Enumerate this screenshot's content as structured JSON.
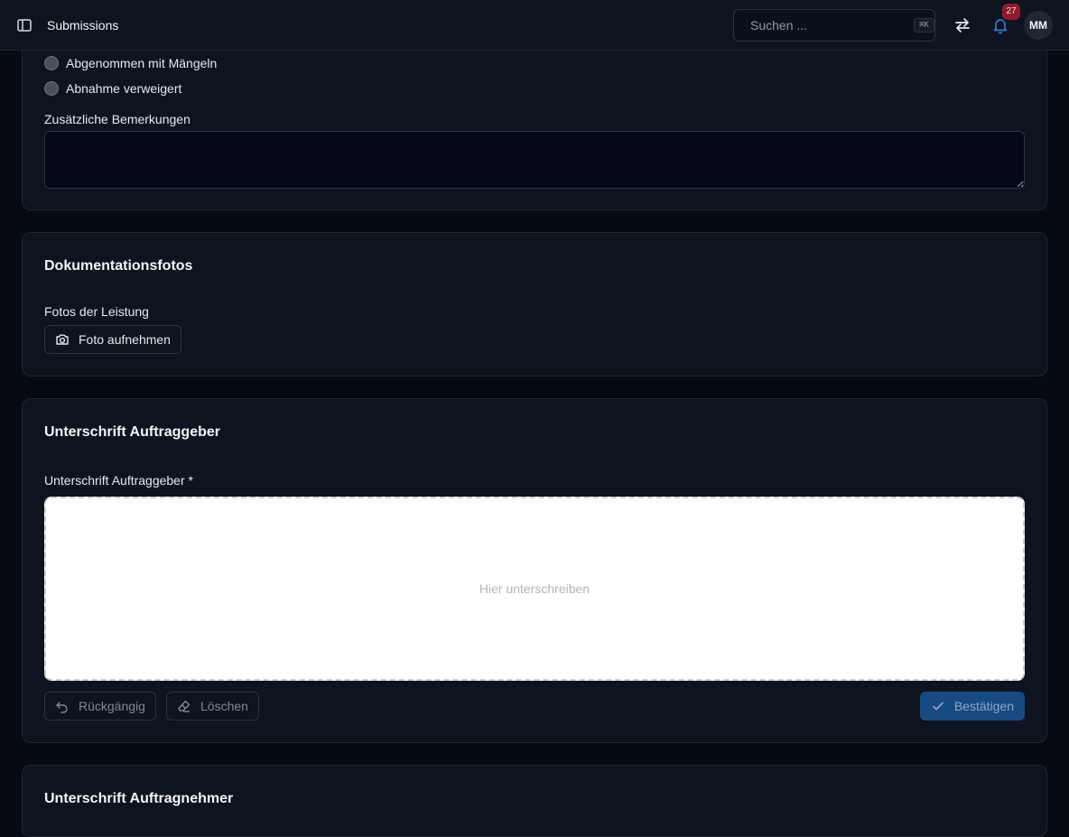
{
  "header": {
    "title": "Submissions",
    "search_placeholder": "Suchen ...",
    "search_shortcut": "⌘K",
    "notification_count": "27",
    "avatar_initials": "MM"
  },
  "acceptance": {
    "options": [
      "Abgenommen mit Mängeln",
      "Abnahme verweigert"
    ],
    "remarks_label": "Zusätzliche Bemerkungen",
    "remarks_value": ""
  },
  "photos": {
    "title": "Dokumentationsfotos",
    "field_label": "Fotos der Leistung",
    "take_photo_label": "Foto aufnehmen"
  },
  "client_signature": {
    "title": "Unterschrift Auftraggeber",
    "field_label": "Unterschrift Auftraggeber *",
    "pad_hint": "Hier unterschreiben",
    "undo_label": "Rückgängig",
    "clear_label": "Löschen",
    "confirm_label": "Bestätigen"
  },
  "contractor_signature": {
    "title": "Unterschrift Auftragnehmer"
  },
  "colors": {
    "background": "#060a12",
    "card": "#0d141f",
    "accent": "#184a82",
    "badge": "#8c1c2c"
  }
}
